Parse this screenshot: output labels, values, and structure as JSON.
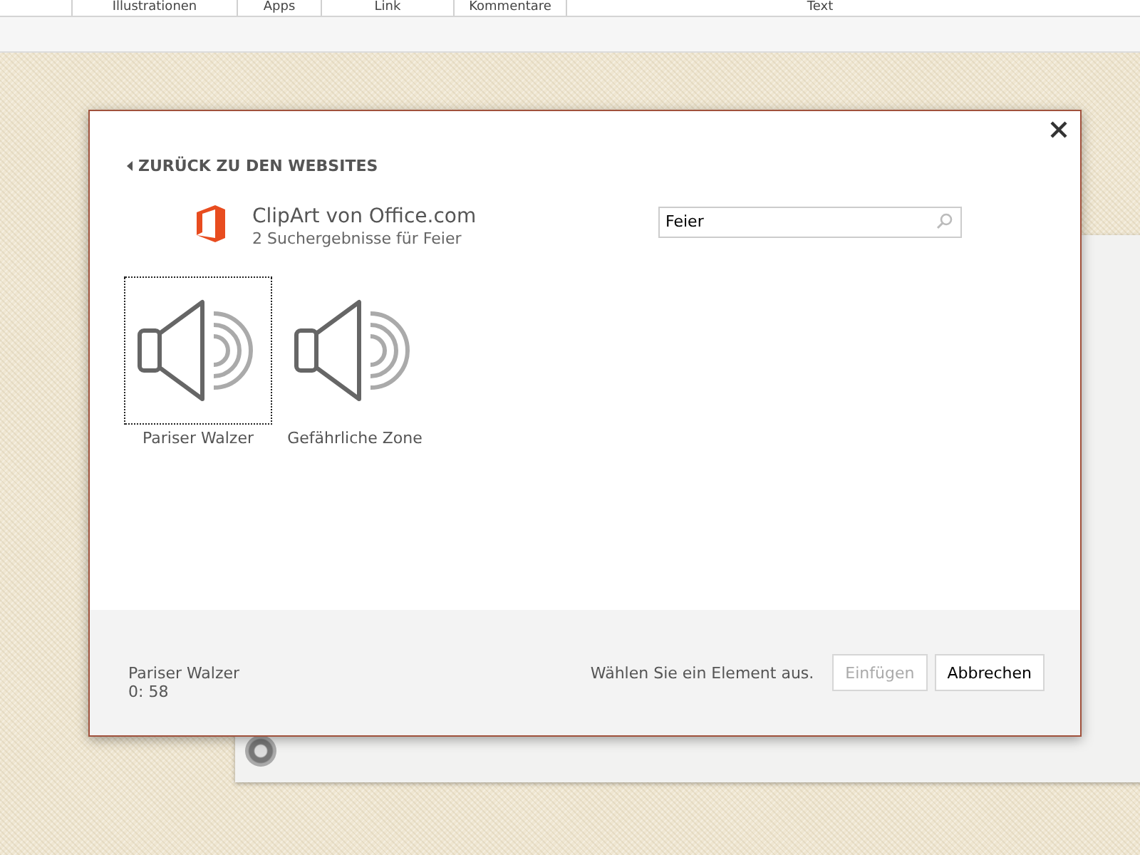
{
  "ribbon": {
    "groups": [
      "Illustrationen",
      "Apps",
      "Link",
      "Kommentare",
      "Text"
    ]
  },
  "dialog": {
    "back_link": "ZURÜCK ZU DEN WEBSITES",
    "source_title": "ClipArt von Office.com",
    "result_summary": "2 Suchergebnisse für Feier",
    "search": {
      "value": "Feier"
    },
    "results": [
      {
        "label": "Pariser Walzer",
        "selected": true
      },
      {
        "label": "Gefährliche Zone",
        "selected": false
      }
    ],
    "footer": {
      "selected_name": "Pariser Walzer",
      "duration": "0: 58",
      "hint": "Wählen Sie ein Element aus.",
      "buttons": [
        {
          "label": "Einfügen",
          "disabled": true
        },
        {
          "label": "Abbrechen",
          "disabled": false
        }
      ]
    }
  }
}
